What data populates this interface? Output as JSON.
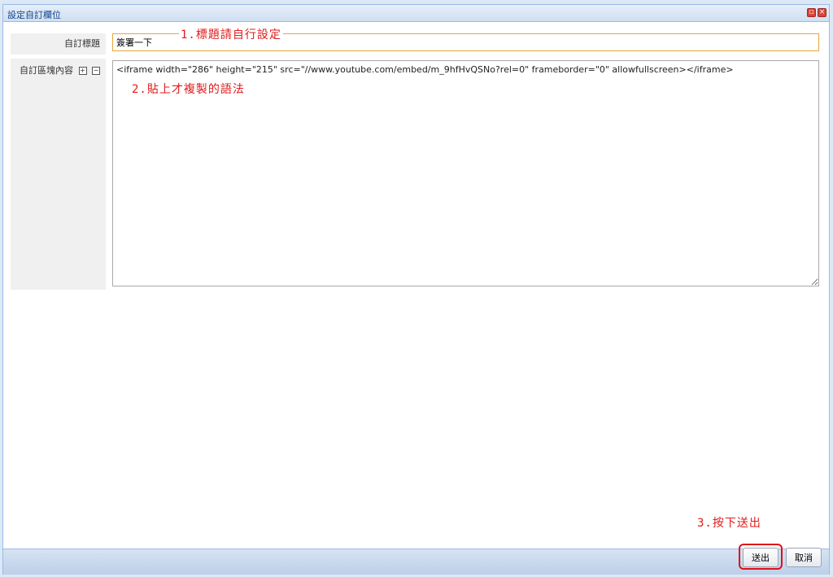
{
  "window": {
    "title": "設定自訂欄位",
    "restore_icon": "restore-icon",
    "close_icon": "close-icon"
  },
  "form": {
    "title_label": "自訂標題",
    "title_value": "簽署一下",
    "content_label": "自訂區塊內容",
    "expand_icon_glyph": "+",
    "collapse_icon_glyph": "−",
    "content_value": "<iframe width=\"286\" height=\"215\" src=\"//www.youtube.com/embed/m_9hfHvQSNo?rel=0\" frameborder=\"0\" allowfullscreen></iframe>"
  },
  "annotations": {
    "step1": "1.標題請自行設定",
    "step2": "2.貼上才複製的語法",
    "step3": "3.按下送出"
  },
  "footer": {
    "submit_label": "送出",
    "cancel_label": "取消"
  },
  "colors": {
    "annotation": "#e21a1a",
    "title_input_border": "#e6a63a",
    "window_border": "#99bbe8"
  }
}
